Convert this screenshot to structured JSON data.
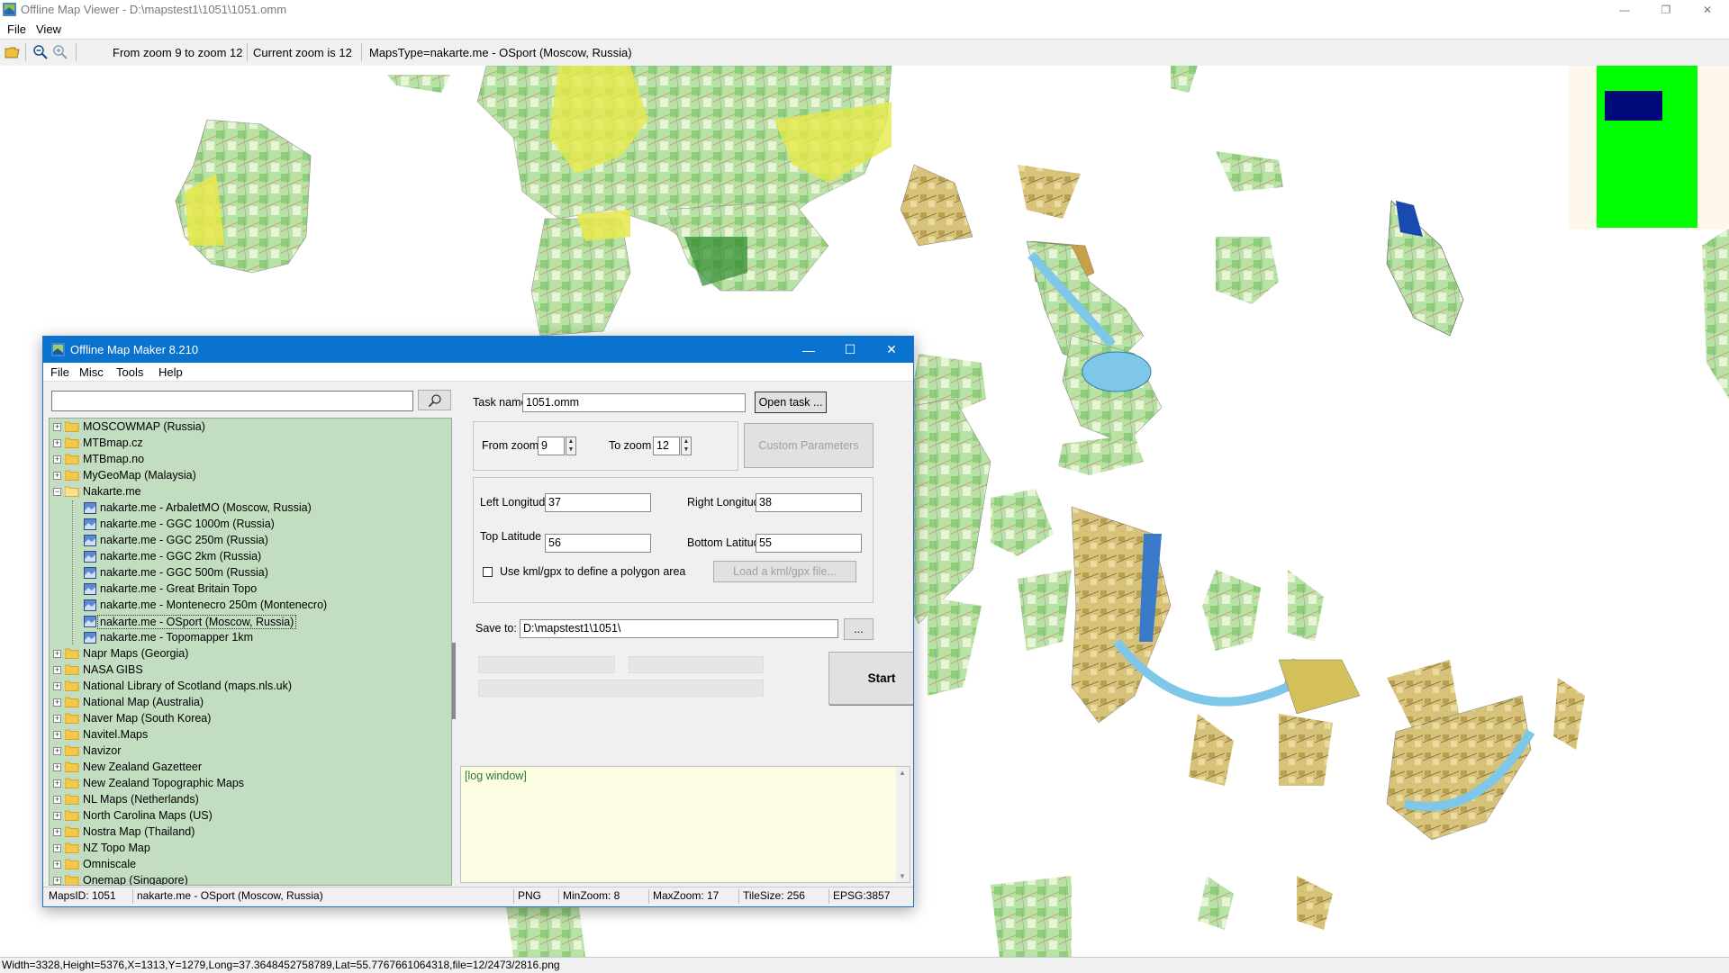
{
  "viewer": {
    "title": "Offline Map Viewer - D:\\mapstest1\\1051\\1051.omm",
    "menu": [
      "File",
      "View"
    ],
    "toolbar": {
      "zoom_range": "From zoom 9 to zoom 12",
      "current_zoom": "Current zoom is 12",
      "maps_type": "MapsType=nakarte.me - OSport (Moscow, Russia)"
    },
    "status": "Width=3328,Height=5376,X=1313,Y=1279,Long=37.3648452758789,Lat=55.7767661064318,file=12/2473/2816.png"
  },
  "maker": {
    "title": "Offline Map Maker 8.210",
    "menu": [
      "File",
      "Misc",
      "Tools",
      "Help"
    ],
    "search": {
      "value": ""
    },
    "tree": [
      {
        "label": "MOSCOWMAP (Russia)",
        "type": "folder"
      },
      {
        "label": "MTBmap.cz",
        "type": "folder"
      },
      {
        "label": "MTBmap.no",
        "type": "folder"
      },
      {
        "label": "MyGeoMap (Malaysia)",
        "type": "folder"
      },
      {
        "label": "Nakarte.me",
        "type": "folder-open"
      },
      {
        "label": "nakarte.me - ArbaletMO (Moscow, Russia)",
        "type": "map"
      },
      {
        "label": "nakarte.me - GGC 1000m (Russia)",
        "type": "map"
      },
      {
        "label": "nakarte.me - GGC 250m (Russia)",
        "type": "map"
      },
      {
        "label": "nakarte.me - GGC 2km (Russia)",
        "type": "map"
      },
      {
        "label": "nakarte.me - GGC 500m (Russia)",
        "type": "map"
      },
      {
        "label": "nakarte.me - Great Britain Topo",
        "type": "map"
      },
      {
        "label": "nakarte.me - Montenecro 250m (Montenecro)",
        "type": "map"
      },
      {
        "label": "nakarte.me - OSport (Moscow, Russia)",
        "type": "map-selected"
      },
      {
        "label": "nakarte.me - Topomapper 1km",
        "type": "map"
      },
      {
        "label": "Napr Maps (Georgia)",
        "type": "folder"
      },
      {
        "label": "NASA GIBS",
        "type": "folder"
      },
      {
        "label": "National Library of Scotland (maps.nls.uk)",
        "type": "folder"
      },
      {
        "label": "National Map (Australia)",
        "type": "folder"
      },
      {
        "label": "Naver Map (South Korea)",
        "type": "folder"
      },
      {
        "label": "Navitel.Maps",
        "type": "folder"
      },
      {
        "label": "Navizor",
        "type": "folder"
      },
      {
        "label": "New Zealand Gazetteer",
        "type": "folder"
      },
      {
        "label": "New Zealand Topographic Maps",
        "type": "folder"
      },
      {
        "label": "NL Maps (Netherlands)",
        "type": "folder"
      },
      {
        "label": "North Carolina Maps (US)",
        "type": "folder"
      },
      {
        "label": "Nostra Map (Thailand)",
        "type": "folder"
      },
      {
        "label": "NZ Topo Map",
        "type": "folder"
      },
      {
        "label": "Omniscale",
        "type": "folder"
      },
      {
        "label": "Onemap (Singapore)",
        "type": "folder"
      }
    ],
    "task": {
      "label": "Task name",
      "value": "1051.omm",
      "open_button": "Open task ..."
    },
    "zoom": {
      "from_label": "From zoom",
      "from_value": "9",
      "to_label": "To zoom",
      "to_value": "12",
      "custom_button": "Custom Parameters"
    },
    "coords": {
      "left_lon_label": "Left Longitude",
      "left_lon": "37",
      "right_lon_label": "Right Longitude",
      "right_lon": "38",
      "top_lat_label": "Top Latitude",
      "top_lat": "56",
      "bottom_lat_label": "Bottom Latitude",
      "bottom_lat": "55",
      "kml_checkbox_label": "Use kml/gpx to define a polygon area",
      "kml_checked": false,
      "load_kml_button": "Load a kml/gpx file..."
    },
    "save": {
      "label": "Save to:",
      "value": "D:\\mapstest1\\1051\\",
      "browse_button": "..."
    },
    "start_button": "Start",
    "log_text": "[log window]",
    "status": {
      "maps_id": "MapsID: 1051",
      "map_name": "nakarte.me - OSport (Moscow, Russia)",
      "format": "PNG",
      "min_zoom": "MinZoom: 8",
      "max_zoom": "MaxZoom: 17",
      "tile_size": "TileSize: 256",
      "epsg": "EPSG:3857"
    }
  },
  "colors": {
    "maker_titlebar": "#0a72cf",
    "tree_bg": "#c3ddc0",
    "log_bg": "#fdfde4",
    "overview_green": "#00ff00",
    "overview_navy": "#000a78"
  }
}
